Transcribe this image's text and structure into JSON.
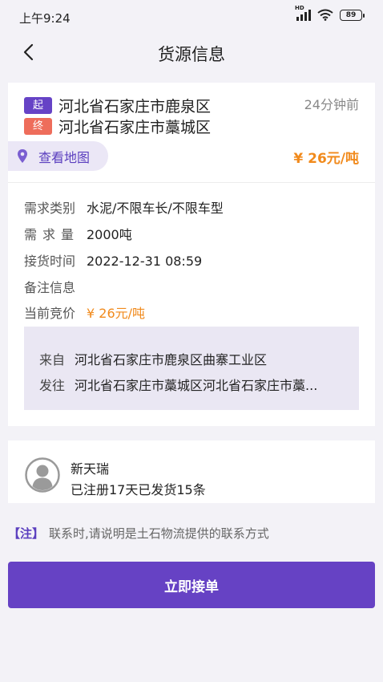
{
  "status_bar": {
    "time": "上午9:24",
    "network_label": "HD",
    "battery": "89"
  },
  "header": {
    "title": "货源信息"
  },
  "route": {
    "from_tag": "起",
    "from": "河北省石家庄市鹿泉区",
    "to_tag": "终",
    "to": "河北省石家庄市藁城区",
    "time_ago": "24分钟前",
    "map_link": "查看地图",
    "price": "¥ 26元/吨"
  },
  "details": {
    "category_label": "需求类别",
    "category_value": "水泥/不限车长/不限车型",
    "quantity_label": "需求量",
    "quantity_value": "2000吨",
    "pickup_label": "接货时间",
    "pickup_value": "2022-12-31 08:59",
    "remark_label": "备注信息",
    "remark_value": "",
    "bid_label": "当前竞价",
    "bid_value": "¥ 26元/吨"
  },
  "address": {
    "from_label": "来自",
    "from_value": "河北省石家庄市鹿泉区曲寨工业区",
    "to_label": "发往",
    "to_value": "河北省石家庄市藁城区河北省石家庄市藁..."
  },
  "user": {
    "name": "新天瑞",
    "stats": "已注册17天已发货15条"
  },
  "notice": {
    "tag": "【注】",
    "text": "联系时,请说明是土石物流提供的联系方式"
  },
  "actions": {
    "accept_label": "立即接单"
  },
  "colors": {
    "accent": "#6642c4",
    "price": "#f18a1c",
    "from_tag": "#6643c6",
    "to_tag": "#ee6d5b"
  },
  "icons": {
    "back": "chevron-left-icon",
    "map": "map-pin-icon",
    "avatar": "user-avatar-icon",
    "wifi": "wifi-icon",
    "signal": "signal-icon",
    "battery": "battery-icon"
  }
}
